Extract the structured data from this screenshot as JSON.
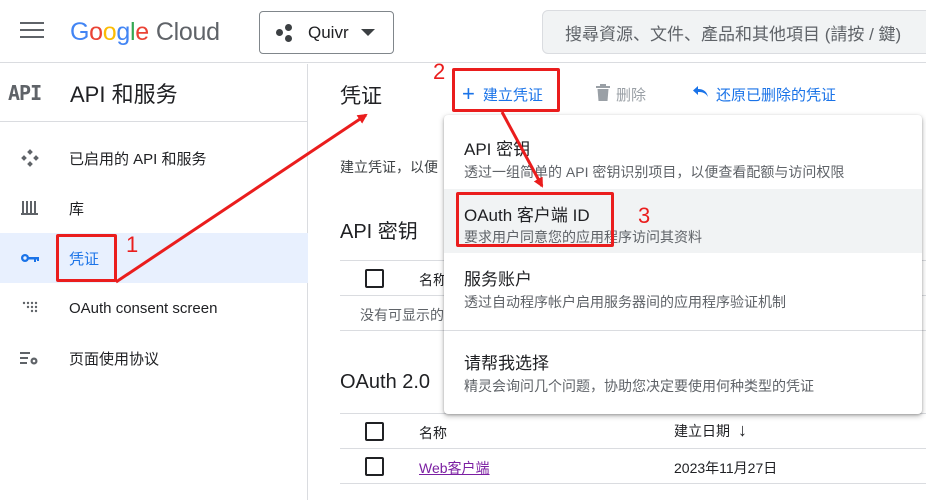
{
  "topbar": {
    "logo": {
      "letters": [
        "G",
        "o",
        "o",
        "g",
        "l",
        "e"
      ],
      "suffix": "Cloud"
    },
    "project": "Quivr",
    "search_placeholder": "搜尋資源、文件、產品和其他項目 (請按 / 鍵)"
  },
  "sidebar": {
    "badge": "API",
    "title": "API 和服务",
    "items": [
      {
        "label": "已启用的 API 和服务",
        "icon": "api-diamond-icon"
      },
      {
        "label": "库",
        "icon": "library-icon"
      },
      {
        "label": "凭证",
        "icon": "key-icon",
        "active": true
      },
      {
        "label": "OAuth consent screen",
        "icon": "consent-dots-icon"
      },
      {
        "label": "页面使用协议",
        "icon": "settings-list-icon"
      }
    ]
  },
  "main": {
    "title": "凭证",
    "toolbar": {
      "create": "建立凭证",
      "delete": "删除",
      "restore": "还原已删除的凭证"
    },
    "intro": "建立凭证，以便",
    "api_keys": {
      "title": "API 密钥",
      "column_name": "名称",
      "empty": "没有可显示的"
    },
    "oauth": {
      "title": "OAuth 2.0",
      "columns": {
        "name": "名称",
        "created": "建立日期"
      },
      "rows": [
        {
          "name": "Web客户端",
          "created": "2023年11月27日"
        }
      ]
    }
  },
  "menu": {
    "items": [
      {
        "title": "API 密钥",
        "desc": "透过一组简单的 API 密钥识别项目，以便查看配额与访问权限"
      },
      {
        "title": "OAuth 客户端 ID",
        "desc": "要求用户同意您的应用程序访问其资料"
      },
      {
        "title": "服务账户",
        "desc": "透过自动程序帐户启用服务器间的应用程序验证机制"
      },
      {
        "title": "请帮我选择",
        "desc": "精灵会询问几个问题，协助您决定要使用何种类型的凭证"
      }
    ]
  },
  "annotations": {
    "step1": "1",
    "step2": "2",
    "step3": "3",
    "color": "#ea1d1d"
  },
  "colors": {
    "accent": "#1a73e8",
    "active_bg": "#e8f0fe",
    "link_visited": "#7b1fa2"
  }
}
